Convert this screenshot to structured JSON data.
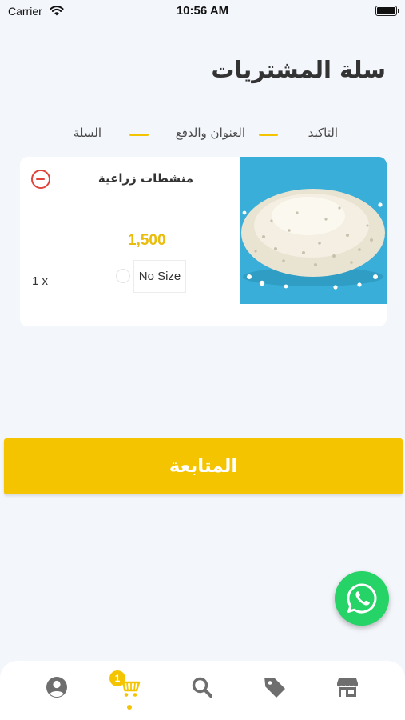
{
  "status_bar": {
    "carrier": "Carrier",
    "time": "10:56 AM"
  },
  "header": {
    "title": "سلة المشتريات"
  },
  "checkout_steps": [
    {
      "label": "التاكيد"
    },
    {
      "label": "العنوان والدفع"
    },
    {
      "label": "السلة"
    }
  ],
  "cart_item": {
    "name": "منشطات زراعية",
    "price": "1,500",
    "size": "No Size",
    "quantity": "1 x",
    "image": "white-granules-on-blue-background"
  },
  "continue_button": {
    "label": "المتابعة"
  },
  "floating": {
    "icon": "whatsapp-icon"
  },
  "tab_bar": {
    "cart_badge": "1",
    "active_tab": "cart",
    "tabs": [
      "profile",
      "cart",
      "search",
      "offers",
      "store"
    ]
  },
  "colors": {
    "accent": "#f5c400",
    "price": "#e9bd0a",
    "remove": "#e0433b",
    "whatsapp": "#25d366",
    "background": "#f3f6fb"
  }
}
